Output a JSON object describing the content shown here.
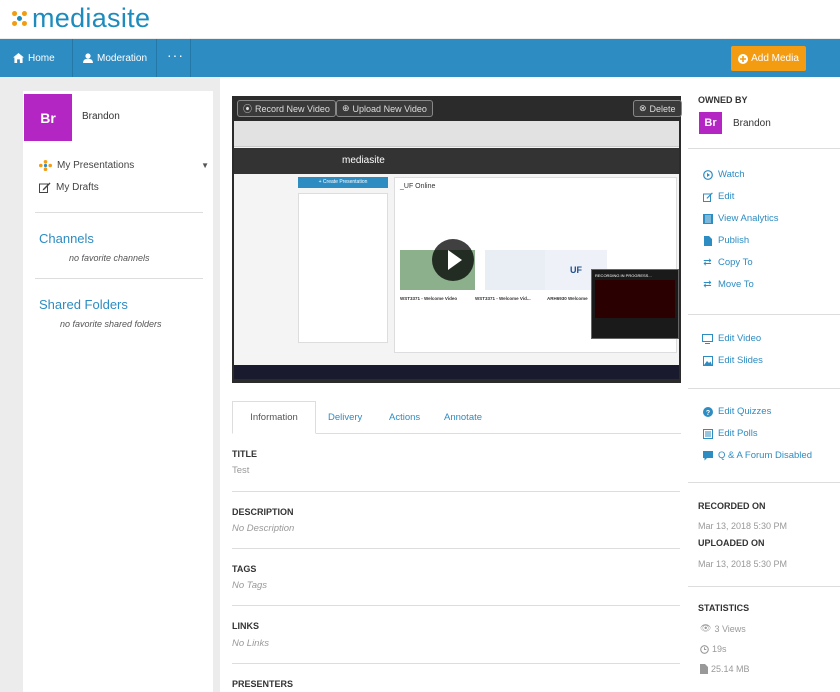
{
  "app": {
    "logo_text": "mediasite"
  },
  "nav": {
    "home_label": "Home",
    "moderation_label": "Moderation",
    "more_label": "···",
    "add_media_label": "Add Media"
  },
  "user": {
    "initials": "Br",
    "name": "Brandon"
  },
  "left_nav": {
    "my_presentations": "My Presentations",
    "my_drafts": "My Drafts",
    "channels_heading": "Channels",
    "channels_empty": "no favorite channels",
    "shared_heading": "Shared Folders",
    "shared_empty": "no favorite shared folders"
  },
  "player": {
    "record_label": "Record New Video",
    "upload_label": "Upload New Video",
    "delete_label": "Delete",
    "screen_title": "_UF Online",
    "screen_brand": "mediasite",
    "screen_create": "+ Create Presentation",
    "video1": "WST3371 - Welcome Video",
    "video2": "WST3371 - Welcome Vid...",
    "video3": "ARH6930 Welcome",
    "recording": "RECORDING IN PROGRESS..."
  },
  "tabs": [
    {
      "label": "Information"
    },
    {
      "label": "Delivery"
    },
    {
      "label": "Actions"
    },
    {
      "label": "Annotate"
    }
  ],
  "fields": {
    "title_label": "TITLE",
    "title_value": "Test",
    "description_label": "DESCRIPTION",
    "description_value": "No Description",
    "tags_label": "TAGS",
    "tags_value": "No Tags",
    "links_label": "LINKS",
    "links_value": "No Links",
    "presenters_label": "PRESENTERS"
  },
  "right": {
    "owned_by_label": "OWNED BY",
    "actions": [
      "Watch",
      "Edit",
      "View Analytics",
      "Publish",
      "Copy To",
      "Move To"
    ],
    "edit_actions": [
      "Edit Video",
      "Edit Slides"
    ],
    "extra_actions": [
      "Edit Quizzes",
      "Edit Polls",
      "Q & A Forum Disabled"
    ],
    "recorded_on_label": "RECORDED ON",
    "recorded_on_value": "Mar 13, 2018 5:30 PM",
    "uploaded_on_label": "UPLOADED ON",
    "uploaded_on_value": "Mar 13, 2018 5:30 PM",
    "statistics_label": "STATISTICS",
    "views": "3 Views",
    "duration": "19s",
    "size": "25.14 MB"
  },
  "colors": {
    "brand_blue": "#2d8cc2",
    "accent_orange": "#f39c12",
    "avatar_purple": "#b426c4"
  }
}
